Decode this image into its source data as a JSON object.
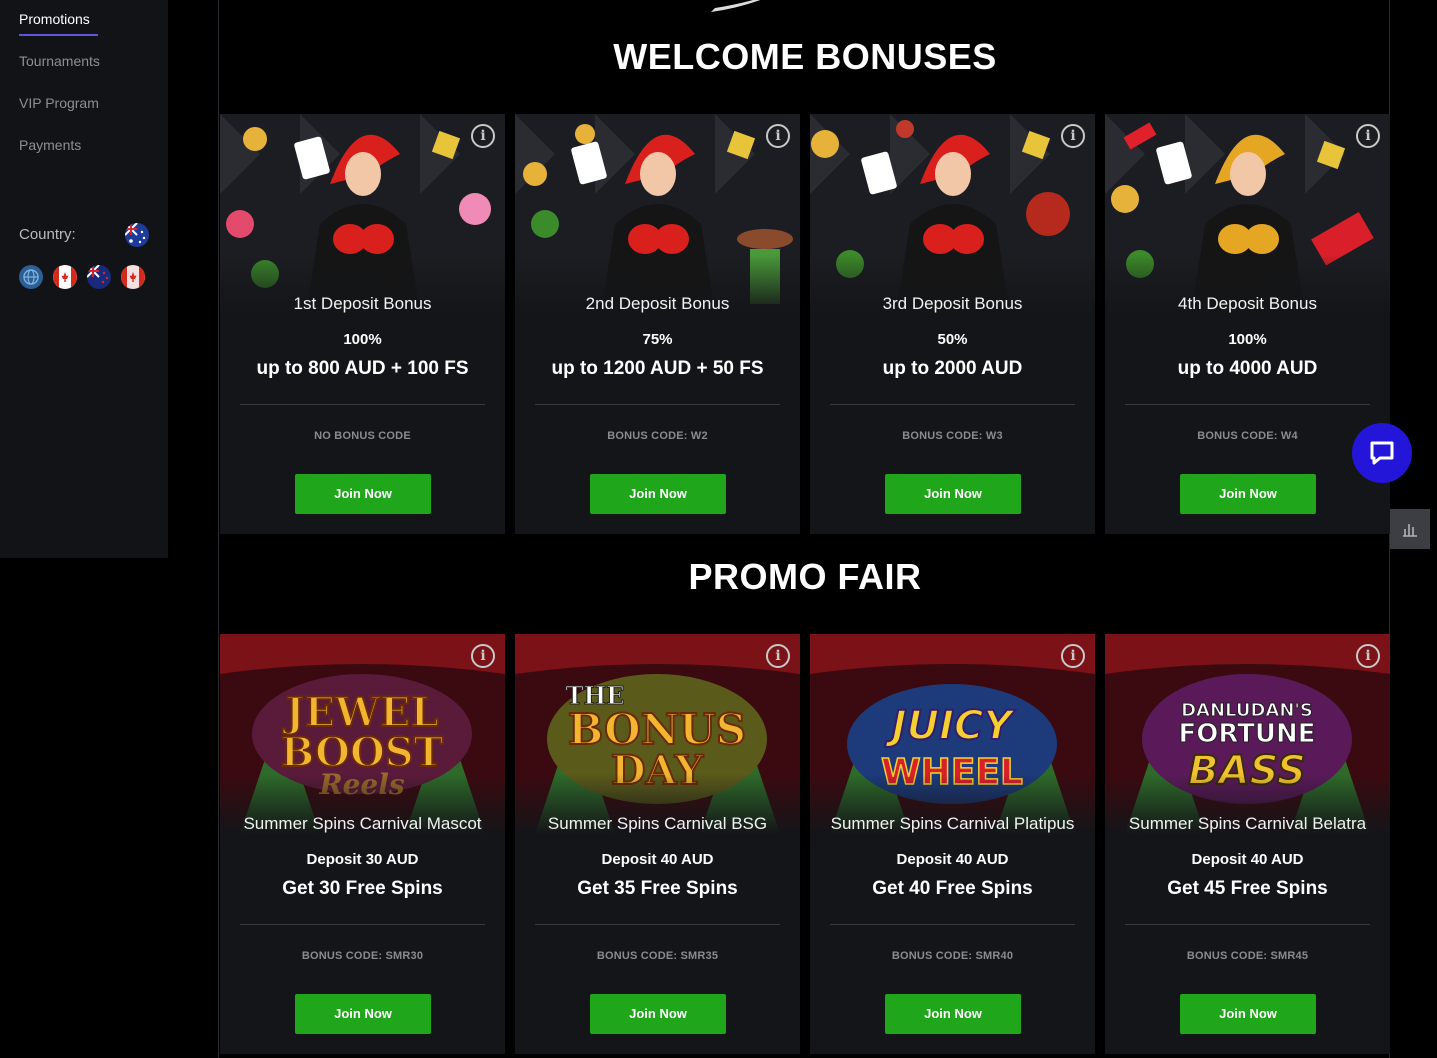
{
  "sidebar": {
    "items": [
      {
        "label": "Promotions",
        "active": true
      },
      {
        "label": "Tournaments",
        "active": false
      },
      {
        "label": "VIP Program",
        "active": false
      },
      {
        "label": "Payments",
        "active": false
      }
    ],
    "country_label": "Country:",
    "selected_country_icon": "australia-flag-icon",
    "country_options_icons": [
      "globe-icon",
      "canada-flag-icon",
      "new-zealand-flag-icon",
      "canada-flag-icon"
    ]
  },
  "welcome": {
    "title": "WELCOME BONUSES",
    "cards": [
      {
        "name": "1st Deposit Bonus",
        "line1": "100%",
        "line2": "up to 800 AUD + 100 FS",
        "code": "NO BONUS CODE",
        "button": "Join Now"
      },
      {
        "name": "2nd Deposit Bonus",
        "line1": "75%",
        "line2": "up to 1200 AUD + 50 FS",
        "code": "BONUS CODE: W2",
        "button": "Join Now"
      },
      {
        "name": "3rd Deposit Bonus",
        "line1": "50%",
        "line2": "up to 2000 AUD",
        "code": "BONUS CODE: W3",
        "button": "Join Now"
      },
      {
        "name": "4th Deposit Bonus",
        "line1": "100%",
        "line2": "up to 4000 AUD",
        "code": "BONUS CODE: W4",
        "button": "Join Now"
      }
    ]
  },
  "promo": {
    "title": "PROMO FAIR",
    "cards": [
      {
        "name": "Summer Spins Carnival Mascot",
        "line1": "Deposit 30 AUD",
        "line2": "Get 30 Free Spins",
        "code": "BONUS CODE: SMR30",
        "button": "Join Now",
        "art_text": [
          "JEWEL",
          "BOOST",
          "Reels"
        ]
      },
      {
        "name": "Summer Spins Carnival BSG",
        "line1": "Deposit 40 AUD",
        "line2": "Get 35 Free Spins",
        "code": "BONUS CODE: SMR35",
        "button": "Join Now",
        "art_text": [
          "THE",
          "BONUS",
          "DAY"
        ]
      },
      {
        "name": "Summer Spins Carnival Platipus",
        "line1": "Deposit 40 AUD",
        "line2": "Get 40 Free Spins",
        "code": "BONUS CODE: SMR40",
        "button": "Join Now",
        "art_text": [
          "JUICY",
          "WHEEL"
        ]
      },
      {
        "name": "Summer Spins Carnival Belatra",
        "line1": "Deposit 40 AUD",
        "line2": "Get 45 Free Spins",
        "code": "BONUS CODE: SMR45",
        "button": "Join Now",
        "art_text": [
          "DANLUDAN'S",
          "FORTUNE",
          "BASS"
        ]
      }
    ]
  },
  "colors": {
    "background": "#000000",
    "card": "#141518",
    "button": "#1fa61a",
    "chat": "#2416d9",
    "nav_accent": "#5f55d8"
  },
  "widgets": {
    "info_icon": "info-icon",
    "chat_icon": "chat-bubble-icon",
    "side_tab_icon": "bar-chart-icon"
  }
}
